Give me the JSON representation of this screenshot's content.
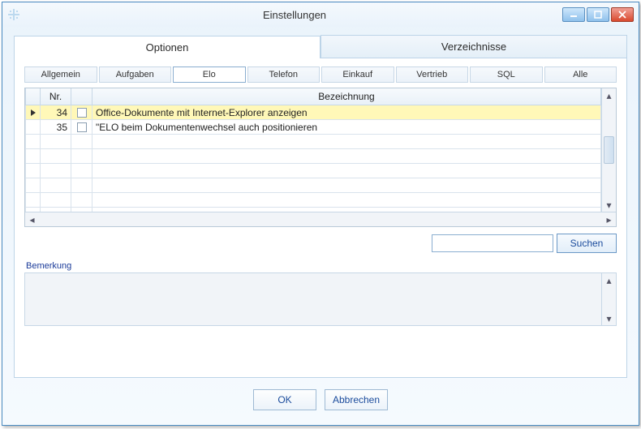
{
  "window": {
    "title": "Einstellungen"
  },
  "mainTabs": [
    {
      "label": "Optionen",
      "active": true
    },
    {
      "label": "Verzeichnisse",
      "active": false
    }
  ],
  "subTabs": [
    {
      "label": "Allgemein",
      "active": false
    },
    {
      "label": "Aufgaben",
      "active": false
    },
    {
      "label": "Elo",
      "active": true
    },
    {
      "label": "Telefon",
      "active": false
    },
    {
      "label": "Einkauf",
      "active": false
    },
    {
      "label": "Vertrieb",
      "active": false
    },
    {
      "label": "SQL",
      "active": false
    },
    {
      "label": "Alle",
      "active": false
    }
  ],
  "grid": {
    "columns": {
      "nr": "Nr.",
      "checkbox": "",
      "bezeichnung": "Bezeichnung"
    },
    "rows": [
      {
        "nr": "34",
        "checked": false,
        "text": "Office-Dokumente mit Internet-Explorer anzeigen",
        "selected": true,
        "current": true
      },
      {
        "nr": "35",
        "checked": false,
        "text": "\"ELO beim Dokumentenwechsel auch positionieren",
        "selected": false,
        "current": false
      }
    ],
    "emptyRows": 6
  },
  "search": {
    "value": "",
    "buttonLabel": "Suchen"
  },
  "remark": {
    "label": "Bemerkung",
    "value": ""
  },
  "footer": {
    "ok": "OK",
    "cancel": "Abbrechen"
  }
}
